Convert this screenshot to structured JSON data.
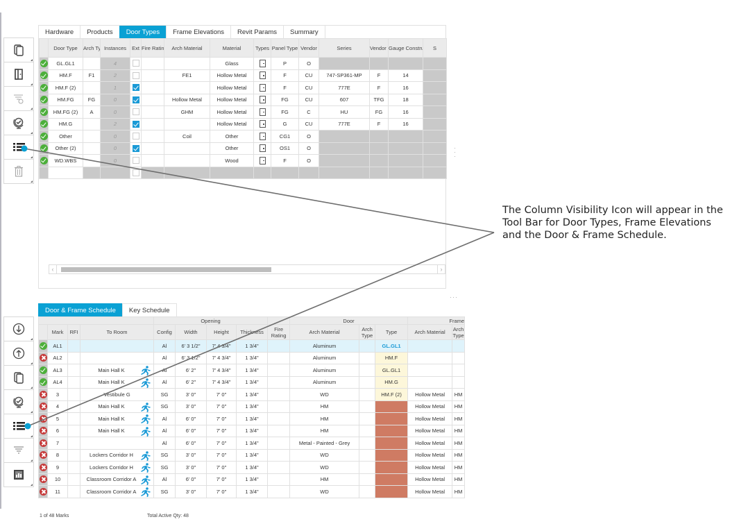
{
  "top_panel": {
    "tabs": [
      {
        "label": "Hardware",
        "active": false
      },
      {
        "label": "Products",
        "active": false
      },
      {
        "label": "Door Types",
        "active": true
      },
      {
        "label": "Frame Elevations",
        "active": false
      },
      {
        "label": "Revit Params",
        "active": false
      },
      {
        "label": "Summary",
        "active": false
      }
    ],
    "toolbar": [
      {
        "icon": "copy-icon"
      },
      {
        "icon": "door-icon"
      },
      {
        "icon": "filter-clear-icon"
      },
      {
        "icon": "globe-check-icon"
      },
      {
        "icon": "column-visibility-icon"
      },
      {
        "icon": "trash-icon"
      }
    ],
    "columns": [
      "",
      "Door Type",
      "Arch Type",
      "Instances",
      "Ext",
      "Fire Rating",
      "Arch Material",
      "Material",
      "Types",
      "Panel Type",
      "Vendor",
      "Series",
      "Vendor Type",
      "Gauge Construction",
      "S"
    ],
    "rows": [
      {
        "status": "ok",
        "door_type": "GL.GL1",
        "arch_type": "",
        "instances": "4",
        "ext": false,
        "fire_rating": "",
        "arch_material": "",
        "material": "Glass",
        "panel_type": "P",
        "vendor": "O",
        "series": "",
        "vendor_type": "",
        "gauge": "",
        "gray_tail": true
      },
      {
        "status": "ok",
        "door_type": "HM.F",
        "arch_type": "F1",
        "instances": "2",
        "ext": false,
        "fire_rating": "",
        "arch_material": "FE1",
        "material": "Hollow Metal",
        "panel_type": "F",
        "vendor": "CU",
        "series": "747-SP361-MP",
        "vendor_type": "F",
        "gauge": "14",
        "gray_tail": false
      },
      {
        "status": "ok",
        "door_type": "HM.F (2)",
        "arch_type": "",
        "instances": "1",
        "ext": true,
        "fire_rating": "",
        "arch_material": "",
        "material": "Hollow Metal",
        "panel_type": "F",
        "vendor": "CU",
        "series": "777E",
        "vendor_type": "F",
        "gauge": "16",
        "gray_tail": false
      },
      {
        "status": "ok",
        "door_type": "HM.FG",
        "arch_type": "FG",
        "instances": "0",
        "ext": true,
        "fire_rating": "",
        "arch_material": "Hollow Metal",
        "material": "Hollow Metal",
        "panel_type": "FG",
        "vendor": "CU",
        "series": "607",
        "vendor_type": "TFG",
        "gauge": "18",
        "gray_tail": false
      },
      {
        "status": "ok",
        "door_type": "HM.FG (2)",
        "arch_type": "A",
        "instances": "0",
        "ext": false,
        "fire_rating": "",
        "arch_material": "GHM",
        "material": "Hollow Metal",
        "panel_type": "FG",
        "vendor": "C",
        "series": "HU",
        "vendor_type": "FG",
        "gauge": "16",
        "gray_tail": false
      },
      {
        "status": "ok",
        "door_type": "HM.G",
        "arch_type": "",
        "instances": "2",
        "ext": true,
        "fire_rating": "",
        "arch_material": "",
        "material": "Hollow Metal",
        "panel_type": "G",
        "vendor": "CU",
        "series": "777E",
        "vendor_type": "F",
        "gauge": "16",
        "gray_tail": false
      },
      {
        "status": "ok",
        "door_type": "Other",
        "arch_type": "",
        "instances": "0",
        "ext": false,
        "fire_rating": "",
        "arch_material": "Coil",
        "material": "Other",
        "panel_type": "CG1",
        "vendor": "O",
        "series": "",
        "vendor_type": "",
        "gauge": "",
        "gray_tail": true
      },
      {
        "status": "ok",
        "door_type": "Other (2)",
        "arch_type": "",
        "instances": "0",
        "ext": true,
        "fire_rating": "",
        "arch_material": "",
        "material": "Other",
        "panel_type": "OS1",
        "vendor": "O",
        "series": "",
        "vendor_type": "",
        "gauge": "",
        "gray_tail": true
      },
      {
        "status": "ok",
        "door_type": "WD.WBS",
        "arch_type": "",
        "instances": "0",
        "ext": false,
        "fire_rating": "",
        "arch_material": "",
        "material": "Wood",
        "panel_type": "F",
        "vendor": "O",
        "series": "",
        "vendor_type": "",
        "gauge": "",
        "gray_tail": true
      }
    ]
  },
  "bottom_panel": {
    "tabs": [
      {
        "label": "Door & Frame Schedule",
        "active": true
      },
      {
        "label": "Key Schedule",
        "active": false
      }
    ],
    "toolbar": [
      {
        "icon": "import-icon"
      },
      {
        "icon": "export-icon"
      },
      {
        "icon": "copy-icon"
      },
      {
        "icon": "globe-check-icon"
      },
      {
        "icon": "column-visibility-icon"
      },
      {
        "icon": "filter-icon"
      },
      {
        "icon": "report-icon"
      }
    ],
    "group_headers": [
      "Opening",
      "Door",
      "Frame"
    ],
    "columns": [
      "",
      "Mark",
      "RFI",
      "To Room",
      "Config",
      "Width",
      "Height",
      "Thickness",
      "Fire Rating",
      "Arch Material",
      "Arch Type",
      "Type",
      "Arch Material",
      "Arch Type"
    ],
    "rows": [
      {
        "status": "ok",
        "mark": "AL1",
        "rfi": "",
        "room": "",
        "exit": false,
        "config": "Al",
        "width": "6' 3 1/2\"",
        "height": "7' 4 3/4\"",
        "thickness": "1 3/4\"",
        "fire": "",
        "door_arch_material": "Aluminum",
        "door_arch_type": "",
        "type": "GL.GL1",
        "type_style": "blue",
        "frame_arch_material": "",
        "frame_arch_type": "",
        "selected": true
      },
      {
        "status": "err",
        "mark": "AL2",
        "rfi": "",
        "room": "",
        "exit": false,
        "config": "Al",
        "width": "6' 3 1/2\"",
        "height": "7' 4 3/4\"",
        "thickness": "1 3/4\"",
        "fire": "",
        "door_arch_material": "Aluminum",
        "door_arch_type": "",
        "type": "HM.F",
        "type_style": "hl",
        "frame_arch_material": "",
        "frame_arch_type": "",
        "selected": false
      },
      {
        "status": "ok",
        "mark": "AL3",
        "rfi": "",
        "room": "Main Hall K",
        "exit": true,
        "config": "Al",
        "width": "6' 2\"",
        "height": "7' 4 3/4\"",
        "thickness": "1 3/4\"",
        "fire": "",
        "door_arch_material": "Aluminum",
        "door_arch_type": "",
        "type": "GL.GL1",
        "type_style": "hl",
        "frame_arch_material": "",
        "frame_arch_type": "",
        "selected": false
      },
      {
        "status": "ok",
        "mark": "AL4",
        "rfi": "",
        "room": "Main Hall K",
        "exit": true,
        "config": "Al",
        "width": "6' 2\"",
        "height": "7' 4 3/4\"",
        "thickness": "1 3/4\"",
        "fire": "",
        "door_arch_material": "Aluminum",
        "door_arch_type": "",
        "type": "HM.G",
        "type_style": "hl",
        "frame_arch_material": "",
        "frame_arch_type": "",
        "selected": false
      },
      {
        "status": "err",
        "mark": "3",
        "rfi": "",
        "room": "Vestibule G",
        "exit": false,
        "config": "SG",
        "width": "3' 0\"",
        "height": "7' 0\"",
        "thickness": "1 3/4\"",
        "fire": "",
        "door_arch_material": "WD",
        "door_arch_type": "",
        "type": "HM.F (2)",
        "type_style": "hl",
        "frame_arch_material": "Hollow Metal",
        "frame_arch_type": "HM",
        "selected": false
      },
      {
        "status": "err",
        "mark": "4",
        "rfi": "",
        "room": "Main Hall K",
        "exit": true,
        "config": "SG",
        "width": "3' 0\"",
        "height": "7' 0\"",
        "thickness": "1 3/4\"",
        "fire": "",
        "door_arch_material": "HM",
        "door_arch_type": "",
        "type": "",
        "type_style": "red",
        "frame_arch_material": "Hollow Metal",
        "frame_arch_type": "HM",
        "selected": false
      },
      {
        "status": "err",
        "mark": "5",
        "rfi": "",
        "room": "Main Hall K",
        "exit": true,
        "config": "Al",
        "width": "6' 0\"",
        "height": "7' 0\"",
        "thickness": "1 3/4\"",
        "fire": "",
        "door_arch_material": "HM",
        "door_arch_type": "",
        "type": "",
        "type_style": "red",
        "frame_arch_material": "Hollow Metal",
        "frame_arch_type": "HM",
        "selected": false
      },
      {
        "status": "err",
        "mark": "6",
        "rfi": "",
        "room": "Main Hall K",
        "exit": true,
        "config": "Al",
        "width": "6' 0\"",
        "height": "7' 0\"",
        "thickness": "1 3/4\"",
        "fire": "",
        "door_arch_material": "HM",
        "door_arch_type": "",
        "type": "",
        "type_style": "red",
        "frame_arch_material": "Hollow Metal",
        "frame_arch_type": "HM",
        "selected": false
      },
      {
        "status": "err",
        "mark": "7",
        "rfi": "",
        "room": "",
        "exit": false,
        "config": "Al",
        "width": "6' 0\"",
        "height": "7' 0\"",
        "thickness": "1 3/4\"",
        "fire": "",
        "door_arch_material": "Metal - Painted - Grey",
        "door_arch_type": "",
        "type": "",
        "type_style": "red",
        "frame_arch_material": "Hollow Metal",
        "frame_arch_type": "HM",
        "selected": false
      },
      {
        "status": "err",
        "mark": "8",
        "rfi": "",
        "room": "Lockers Corridor H",
        "exit": true,
        "config": "SG",
        "width": "3' 0\"",
        "height": "7' 0\"",
        "thickness": "1 3/4\"",
        "fire": "",
        "door_arch_material": "WD",
        "door_arch_type": "",
        "type": "",
        "type_style": "red",
        "frame_arch_material": "Hollow Metal",
        "frame_arch_type": "HM",
        "selected": false
      },
      {
        "status": "err",
        "mark": "9",
        "rfi": "",
        "room": "Lockers Corridor H",
        "exit": true,
        "config": "SG",
        "width": "3' 0\"",
        "height": "7' 0\"",
        "thickness": "1 3/4\"",
        "fire": "",
        "door_arch_material": "WD",
        "door_arch_type": "",
        "type": "",
        "type_style": "red",
        "frame_arch_material": "Hollow Metal",
        "frame_arch_type": "HM",
        "selected": false
      },
      {
        "status": "err",
        "mark": "10",
        "rfi": "",
        "room": "Classroom Corridor A",
        "exit": true,
        "config": "Al",
        "width": "6' 0\"",
        "height": "7' 0\"",
        "thickness": "1 3/4\"",
        "fire": "",
        "door_arch_material": "HM",
        "door_arch_type": "",
        "type": "",
        "type_style": "red",
        "frame_arch_material": "Hollow Metal",
        "frame_arch_type": "HM",
        "selected": false
      },
      {
        "status": "err",
        "mark": "11",
        "rfi": "",
        "room": "Classroom Corridor A",
        "exit": true,
        "config": "SG",
        "width": "3' 0\"",
        "height": "7' 0\"",
        "thickness": "1 3/4\"",
        "fire": "",
        "door_arch_material": "WD",
        "door_arch_type": "",
        "type": "",
        "type_style": "red",
        "frame_arch_material": "Hollow Metal",
        "frame_arch_type": "HM",
        "selected": false
      }
    ],
    "footer": {
      "marks_count": "1 of 48 Marks",
      "total_qty": "Total Active Qty: 48"
    }
  },
  "callout": {
    "text": "The Column Visibility Icon will appear in the Tool Bar for Door Types, Frame Elevations and the Door & Frame Schedule."
  },
  "colors": {
    "accent": "#0aa1d4",
    "ok": "#4caf3a",
    "error": "#c63a3a",
    "type_missing": "#cf7b63",
    "type_highlight": "#fdf7da",
    "selected_row": "#dff3fb"
  }
}
